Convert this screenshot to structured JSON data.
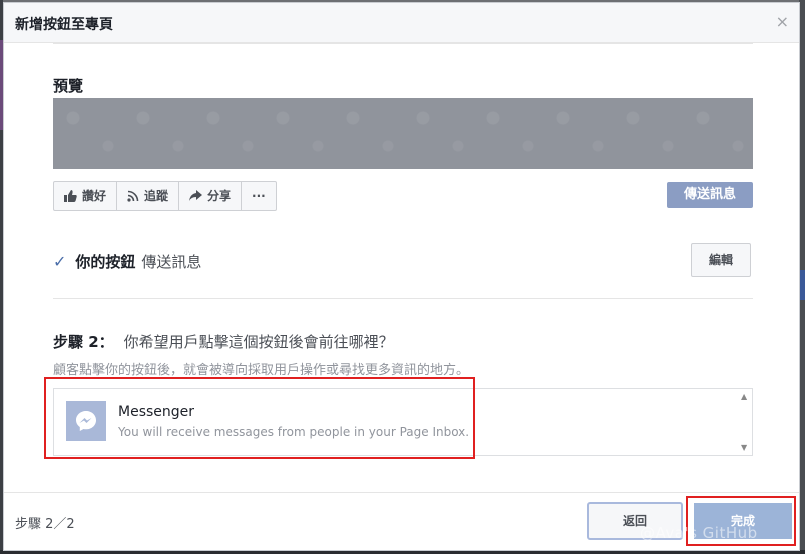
{
  "dialog": {
    "title": "新增按鈕至專頁",
    "close_glyph": "×"
  },
  "preview": {
    "label": "預覽",
    "actions": [
      {
        "label": "讚好",
        "icon": "thumbs-up-icon"
      },
      {
        "label": "追蹤",
        "icon": "rss-icon"
      },
      {
        "label": "分享",
        "icon": "share-arrow-icon"
      },
      {
        "label": "···",
        "icon": "more-icon"
      }
    ],
    "send_button": "傳送訊息"
  },
  "your_button": {
    "label": "你的按鈕",
    "value": "傳送訊息",
    "edit": "編輯"
  },
  "step2": {
    "label": "步驟 2：",
    "question": "你希望用戶點擊這個按鈕後會前往哪裡？",
    "hint": "顧客點擊你的按鈕後，就會被導向採取用戶操作或尋找更多資訊的地方。"
  },
  "option": {
    "title": "Messenger",
    "description": "You will receive messages from people in your Page Inbox.",
    "icon": "messenger-icon"
  },
  "footer": {
    "step_count": "步驟 2／2",
    "back": "返回",
    "done": "完成"
  },
  "watermark": "@Ava's GitHub",
  "colors": {
    "accent": "#4b6ea9",
    "highlight": "#e02020",
    "send_button": "#8b9dc3"
  }
}
